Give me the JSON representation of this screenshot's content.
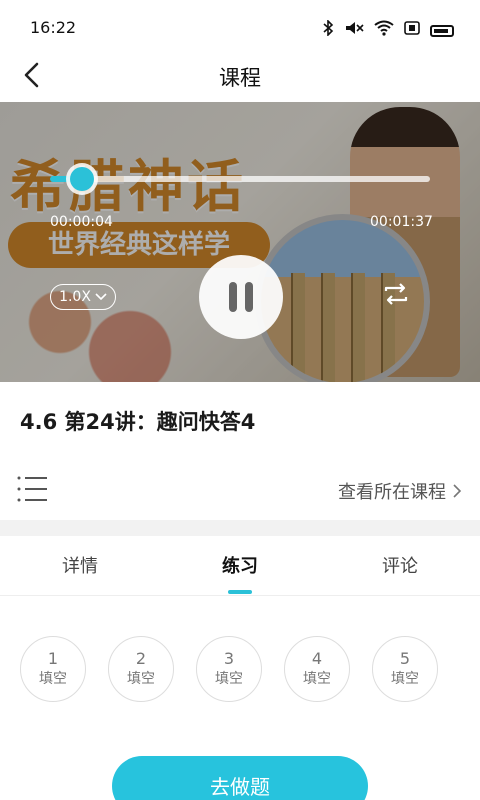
{
  "status_bar": {
    "time": "16:22",
    "icons": [
      "bluetooth-icon",
      "mute-icon",
      "wifi-icon",
      "sim-icon",
      "battery-icon"
    ]
  },
  "header": {
    "title": "课程",
    "back_icon": "chevron-left-icon"
  },
  "video": {
    "cover_title": "希腊神话",
    "cover_subtitle": "世界经典这样学",
    "current_time": "00:00:04",
    "total_time": "00:01:37",
    "speed": "1.0X",
    "progress": 0.04,
    "accent_color": "#2bc1d8"
  },
  "lesson": {
    "title": "4.6 第24讲：趣问快答4"
  },
  "course_row": {
    "view_course_label": "查看所在课程"
  },
  "tabs": [
    {
      "label": "详情",
      "active": false
    },
    {
      "label": "练习",
      "active": true
    },
    {
      "label": "评论",
      "active": false
    }
  ],
  "exercises": [
    {
      "num": "1",
      "type": "填空"
    },
    {
      "num": "2",
      "type": "填空"
    },
    {
      "num": "3",
      "type": "填空"
    },
    {
      "num": "4",
      "type": "填空"
    },
    {
      "num": "5",
      "type": "填空"
    }
  ],
  "action": {
    "go_label": "去做题"
  }
}
